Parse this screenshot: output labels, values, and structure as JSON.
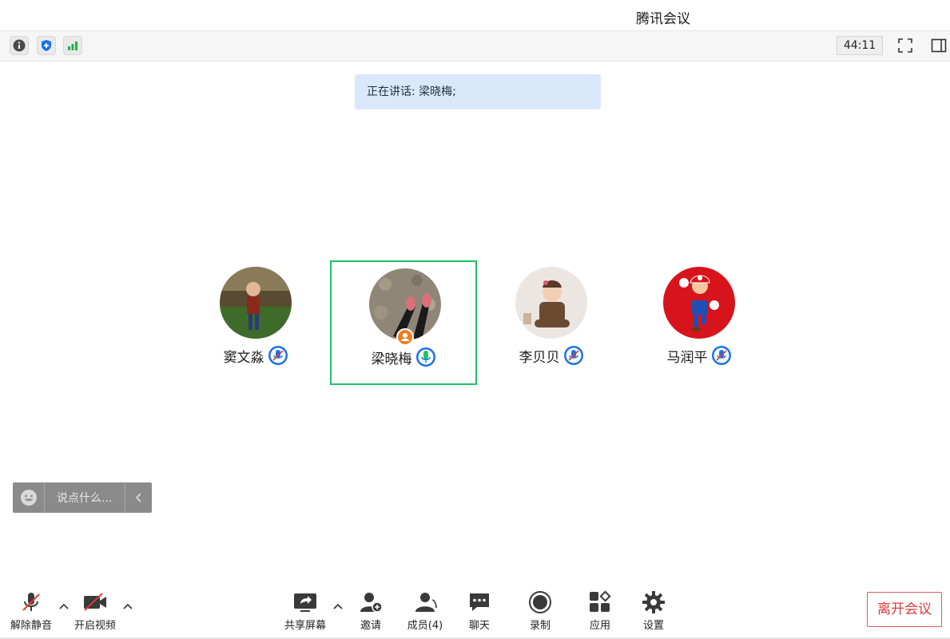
{
  "window": {
    "title": "腾讯会议"
  },
  "status": {
    "timer": "44:11",
    "icons": [
      "info-icon",
      "shield-icon",
      "signal-icon"
    ],
    "right_icons": [
      "fullscreen-icon",
      "sidebar-toggle-icon"
    ]
  },
  "speaking_banner": "正在讲话: 梁晓梅;",
  "participants": [
    {
      "name": "窦文淼",
      "mic": "muted",
      "active": false
    },
    {
      "name": "梁晓梅",
      "mic": "on",
      "active": true,
      "host": true
    },
    {
      "name": "李贝贝",
      "mic": "muted",
      "active": false
    },
    {
      "name": "马润平",
      "mic": "muted",
      "active": false
    }
  ],
  "chat": {
    "placeholder": "说点什么..."
  },
  "toolbar": {
    "unmute": "解除静音",
    "start_video": "开启视频",
    "share_screen": "共享屏幕",
    "invite": "邀请",
    "members": "成员(4)",
    "chat": "聊天",
    "record": "录制",
    "apps": "应用",
    "settings": "设置",
    "leave": "离开会议"
  },
  "colors": {
    "active_border": "#1fbf6a",
    "mic_blue": "#1a73e8",
    "leave_red": "#e0393e",
    "banner_bg": "#d9e8fb"
  }
}
